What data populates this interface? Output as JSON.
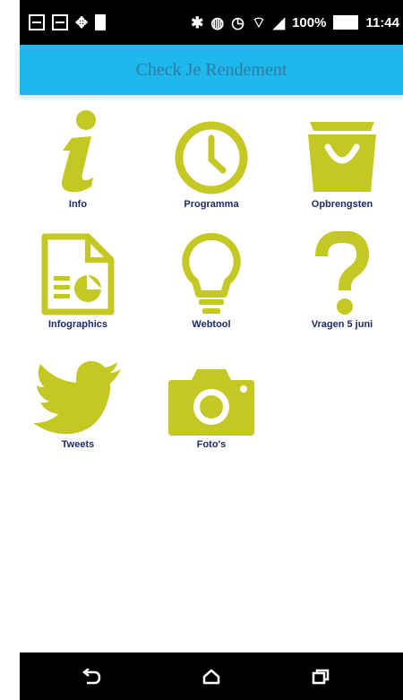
{
  "status_bar": {
    "battery_percent": "100%",
    "time": "11:44"
  },
  "app_bar": {
    "title": "Check Je Rendement"
  },
  "tiles": [
    {
      "label": "Info",
      "icon": "info-icon"
    },
    {
      "label": "Programma",
      "icon": "clock-icon"
    },
    {
      "label": "Opbrengsten",
      "icon": "shopping-bag-icon"
    },
    {
      "label": "Infographics",
      "icon": "document-chart-icon"
    },
    {
      "label": "Webtool",
      "icon": "lightbulb-icon"
    },
    {
      "label": "Vragen 5 juni",
      "icon": "question-mark-icon"
    },
    {
      "label": "Tweets",
      "icon": "twitter-bird-icon"
    },
    {
      "label": "Foto's",
      "icon": "camera-icon"
    }
  ],
  "nav_bar": {
    "buttons": [
      "back-icon",
      "home-icon",
      "recent-apps-icon"
    ]
  },
  "colors": {
    "accent": "#c4c823",
    "app_bar": "#1fb8ec",
    "title_text": "#2f7aa3",
    "label_text": "#1c2a6b"
  }
}
